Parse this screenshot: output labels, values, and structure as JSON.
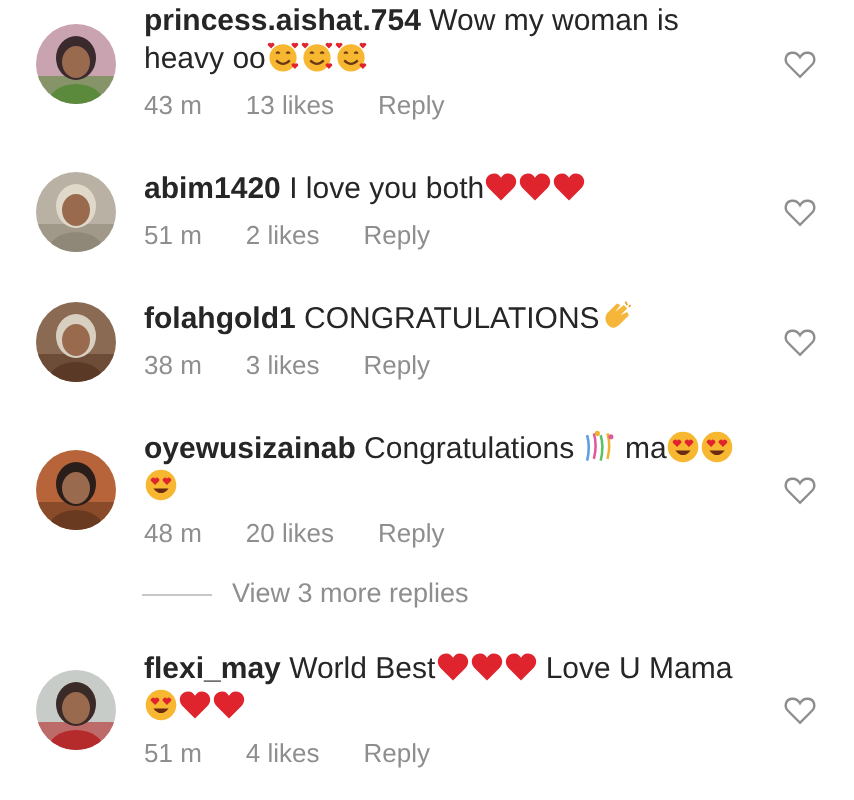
{
  "comments": [
    {
      "username": "princess.aishat.754",
      "liked": false,
      "time": "43 m",
      "likes": "13 likes",
      "reply": "Reply",
      "avatar": {
        "kind": "picture"
      },
      "body": [
        {
          "kind": "text",
          "text": "Wow my woman is heavy oo"
        },
        {
          "kind": "smiling-hearts"
        },
        {
          "kind": "smiling-hearts"
        },
        {
          "kind": "smiling-hearts"
        }
      ]
    },
    {
      "username": "abim1420",
      "liked": false,
      "time": "51 m",
      "likes": "2 likes",
      "reply": "Reply",
      "avatar": {
        "kind": "picture"
      },
      "body": [
        {
          "kind": "text",
          "text": "I love you both"
        },
        {
          "kind": "heart"
        },
        {
          "kind": "heart"
        },
        {
          "kind": "heart"
        }
      ]
    },
    {
      "username": "folahgold1",
      "liked": false,
      "time": "38 m",
      "likes": "3 likes",
      "reply": "Reply",
      "avatar": {
        "kind": "picture"
      },
      "body": [
        {
          "kind": "text",
          "text": "CONGRATULATIONS"
        },
        {
          "kind": "clap"
        }
      ]
    },
    {
      "username": "oyewusizainab",
      "liked": false,
      "time": "48 m",
      "likes": "20 likes",
      "reply": "Reply",
      "avatar": {
        "kind": "picture"
      },
      "body": [
        {
          "kind": "text",
          "text": "Congratulations "
        },
        {
          "kind": "confetti"
        },
        {
          "kind": "text",
          "text": " ma"
        },
        {
          "kind": "heart-eyes"
        },
        {
          "kind": "heart-eyes"
        },
        {
          "kind": "heart-eyes"
        }
      ],
      "view_replies": "View 3 more replies"
    },
    {
      "username": "flexi_may",
      "liked": false,
      "time": "51 m",
      "likes": "4 likes",
      "reply": "Reply",
      "avatar": {
        "kind": "picture"
      },
      "body": [
        {
          "kind": "text",
          "text": "World Best"
        },
        {
          "kind": "heart"
        },
        {
          "kind": "heart"
        },
        {
          "kind": "heart"
        },
        {
          "kind": "text",
          "text": " Love U Mama "
        },
        {
          "kind": "heart-eyes"
        },
        {
          "kind": "heart"
        },
        {
          "kind": "heart"
        }
      ]
    }
  ]
}
